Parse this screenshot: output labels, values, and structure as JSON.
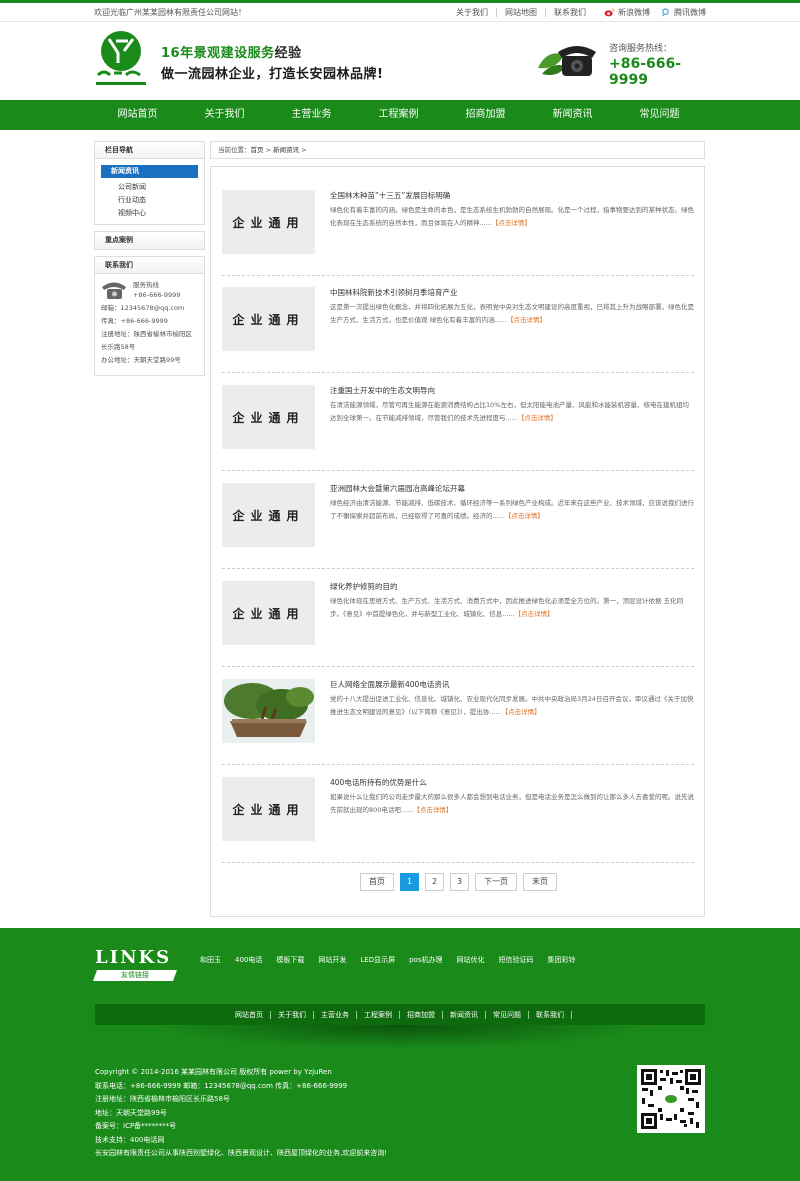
{
  "topbar": {
    "welcome": "欢迎光临广州某某园林有限责任公司网站！",
    "links": [
      "关于我们",
      "网站地图",
      "联系我们"
    ],
    "sina": "新浪微博",
    "tencent": "腾讯微博"
  },
  "header": {
    "slogan1_a": "16年景观建设服务",
    "slogan1_b": "经验",
    "slogan2": "做一流园林企业，打造长安园林品牌!",
    "hotline_label": "咨询服务热线：",
    "hotline_number": "+86-666-9999"
  },
  "nav": [
    "网站首页",
    "关于我们",
    "主营业务",
    "工程案例",
    "招商加盟",
    "新闻资讯",
    "常见问题"
  ],
  "sidebar": {
    "nav_title": "栏目导航",
    "category": "新闻资讯",
    "subs": [
      "公司新闻",
      "行业动态",
      "视频中心"
    ],
    "featured_title": "重点案例",
    "contact_title": "联系我们",
    "tel_label": "服务热线",
    "tel_value": "+86-666-9999",
    "lines": [
      "邮箱：12345678@qq.com",
      "传真：+86-666-9999",
      "注册地址：陕西省榆林市榆阳区",
      "长乐路58号",
      "办公地址：天朝天堂路99号"
    ]
  },
  "breadcrumb": {
    "prefix": "当前位置：",
    "home": "首页",
    "sep": " > ",
    "section": "新闻资讯",
    "tail": " >"
  },
  "news": [
    {
      "title": "全国林木种苗“十三五”发展目标明确",
      "desc": "绿色化有着丰富的内涵。绿色是生命的本色，是生态系统生机勃勃的自然展现。化是一个过程，指事物要达到的某种状态。绿色化表现在生态系统的自然本性，而且体现在人的精神......",
      "more": "【点击详情】",
      "thumb": "企业通用"
    },
    {
      "title": "中国林科院新技术引领树月季培育产业",
      "desc": "这是第一次提出绿色化概念，并将四化拓展为五化，表明党中央对生态文明建设的高度重视，已将其上升为战略部署。绿色化是生产方式、生活方式，也是价值观 绿色化有着丰富的内涵......",
      "more": "【点击详情】",
      "thumb": "企业通用"
    },
    {
      "title": "注重国土开发中的生态文明导向",
      "desc": "在清洁能源领域，尽管可再生能源在能源消费结构占比10%左右，但太阳能电池产量、风能和水能装机容量、核电在建机组均达到全球第一。在节能减排领域，尽管我们的技术先进程度与......",
      "more": "【点击详情】",
      "thumb": "企业通用"
    },
    {
      "title": "亚洲园林大会暨第六届园冶高峰论坛开幕",
      "desc": "绿色经济由清洁能源、节能减排、低碳技术、循环经济等一系列绿色产业构成。近年来在这些产业、技术领域，应该说我们进行了不懈探索并超前布局，已经取得了可喜的成绩。经济的......",
      "more": "【点击详情】",
      "thumb": "企业通用"
    },
    {
      "title": "绿化养护修剪的目的",
      "desc": "绿色化体现在思维方式、生产方式、生活方式、消费方式中，因此推进绿色化必须是全方位的。第一，顶层设计依据 五化同步。《意见》中首提绿色化，并与新型工业化、城镇化、信息......",
      "more": "【点击详情】",
      "thumb": "企业通用"
    },
    {
      "title": "巨人网络全面展示最新400电话资讯",
      "desc": "党的十八大提出促进工业化、信息化、城镇化、农业现代化同步发展。中共中央政治局3月24日召开会议，审议通过《关于加快推进生态文明建设的意见》（以下简称《意见》），提出协......",
      "more": "【点击详情】",
      "thumb": ""
    },
    {
      "title": "400电话所持有的优势是什么",
      "desc": "如果说什么让我们的公司走步最大的那么很多人都会想到电话业务，但是电话业务是怎么做到的让那么多人去喜爱的呢。说先说先前就出现的800电话吧......",
      "more": "【点击详情】",
      "thumb": "企业通用"
    }
  ],
  "pager": {
    "first": "首页",
    "pages": [
      "1",
      "2",
      "3"
    ],
    "current": "1",
    "next": "下一页",
    "last": "末页"
  },
  "footer": {
    "links_big": "LINKS",
    "links_tag": "友情链接",
    "friends": [
      "和田玉",
      "400电话",
      "模板下载",
      "网站开发",
      "LED显示屏",
      "pos机办理",
      "网站优化",
      "短信验证码",
      "集团彩铃"
    ],
    "nav": [
      "网站首页",
      "关于我们",
      "主营业务",
      "工程案例",
      "招商加盟",
      "新闻资讯",
      "常见问题",
      "联系我们"
    ],
    "copy": [
      "Copyright © 2014-2016 某某园林有限公司 版权所有 power by YzjuRen",
      "联系电话：+86-666-9999        邮箱：12345678@qq.com 传真：+86-666-9999",
      "注册地址：陕西省榆林市榆阳区长乐路58号",
      "地址：天朝天堂路99号",
      "备案号：ICP备********号",
      "技术支持：400电话网",
      "长安园林有限责任公司从事陕西别墅绿化、陕西景观设计、陕西屋顶绿化的业务,欢迎前来咨询!"
    ]
  },
  "colors": {
    "brand_green": "#1a8a1a",
    "dark_green": "#0d6a0d",
    "accent_blue": "#1a9ae0",
    "more_orange": "#e07020"
  }
}
